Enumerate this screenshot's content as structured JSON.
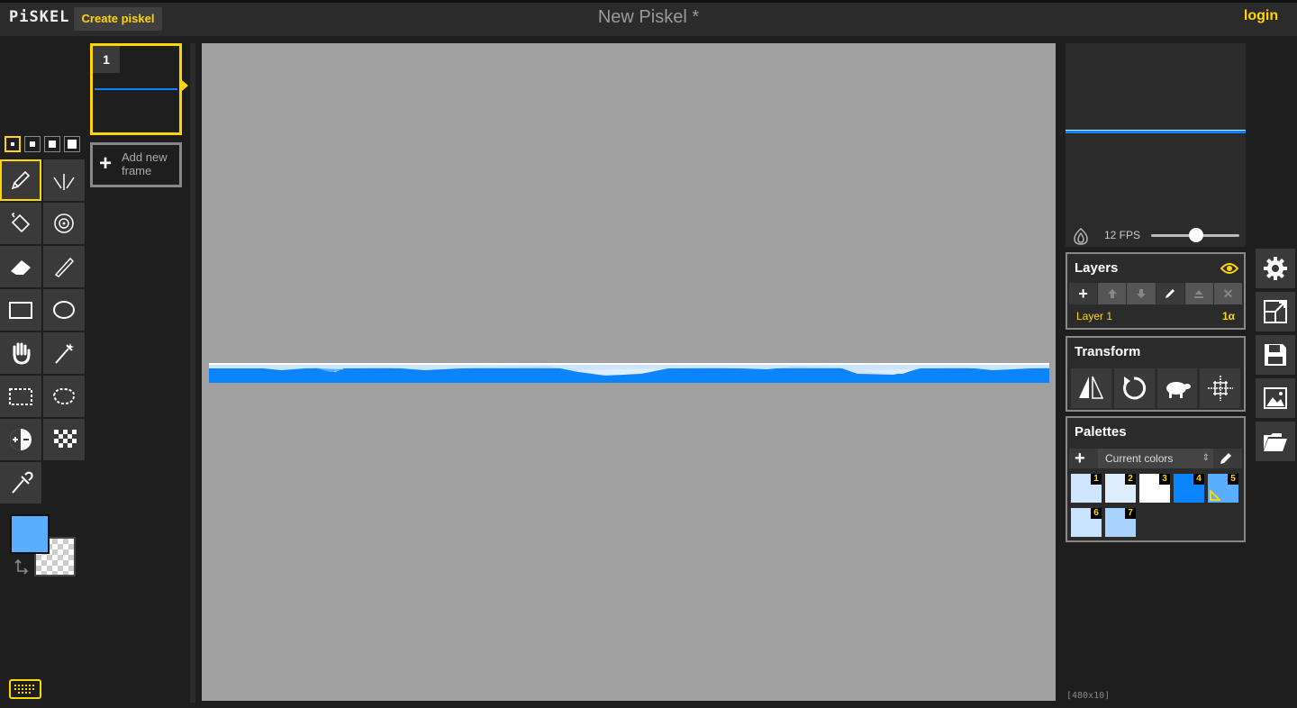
{
  "header": {
    "logo": "PiSKEL",
    "create_button": "Create piskel",
    "title": "New Piskel *",
    "login": "login"
  },
  "tools": {
    "pen_sizes": [
      1,
      2,
      3,
      4
    ],
    "items": [
      "pen-tool",
      "vertical-mirror-pen-tool",
      "paint-bucket-tool",
      "paint-all-same-color-tool",
      "eraser-tool",
      "stroke-tool",
      "rectangle-tool",
      "circle-tool",
      "move-tool",
      "shape-selection-tool",
      "rectangle-selection-tool",
      "lasso-selection-tool",
      "lighten-tool",
      "dithering-tool",
      "color-picker-tool"
    ],
    "primary_color": "#5aaeff",
    "secondary_color": "transparent"
  },
  "frames": {
    "items": [
      {
        "number": "1"
      }
    ],
    "add_label": "Add new frame"
  },
  "preview": {
    "fps_label": "12 FPS",
    "fps": 12
  },
  "layers": {
    "title": "Layers",
    "items": [
      {
        "name": "Layer 1",
        "opacity": "1α"
      }
    ]
  },
  "transform": {
    "title": "Transform"
  },
  "palettes": {
    "title": "Palettes",
    "selected": "Current colors",
    "colors": [
      {
        "n": "1",
        "hex": "#cde5ff"
      },
      {
        "n": "2",
        "hex": "#dfeefd"
      },
      {
        "n": "3",
        "hex": "#ffffff"
      },
      {
        "n": "4",
        "hex": "#0a84ff"
      },
      {
        "n": "5",
        "hex": "#5aaeff"
      },
      {
        "n": "6",
        "hex": "#c8e3ff"
      },
      {
        "n": "7",
        "hex": "#a8d3ff"
      }
    ]
  },
  "canvas": {
    "size_label": "[480x10]"
  },
  "accent": "#ffd700"
}
